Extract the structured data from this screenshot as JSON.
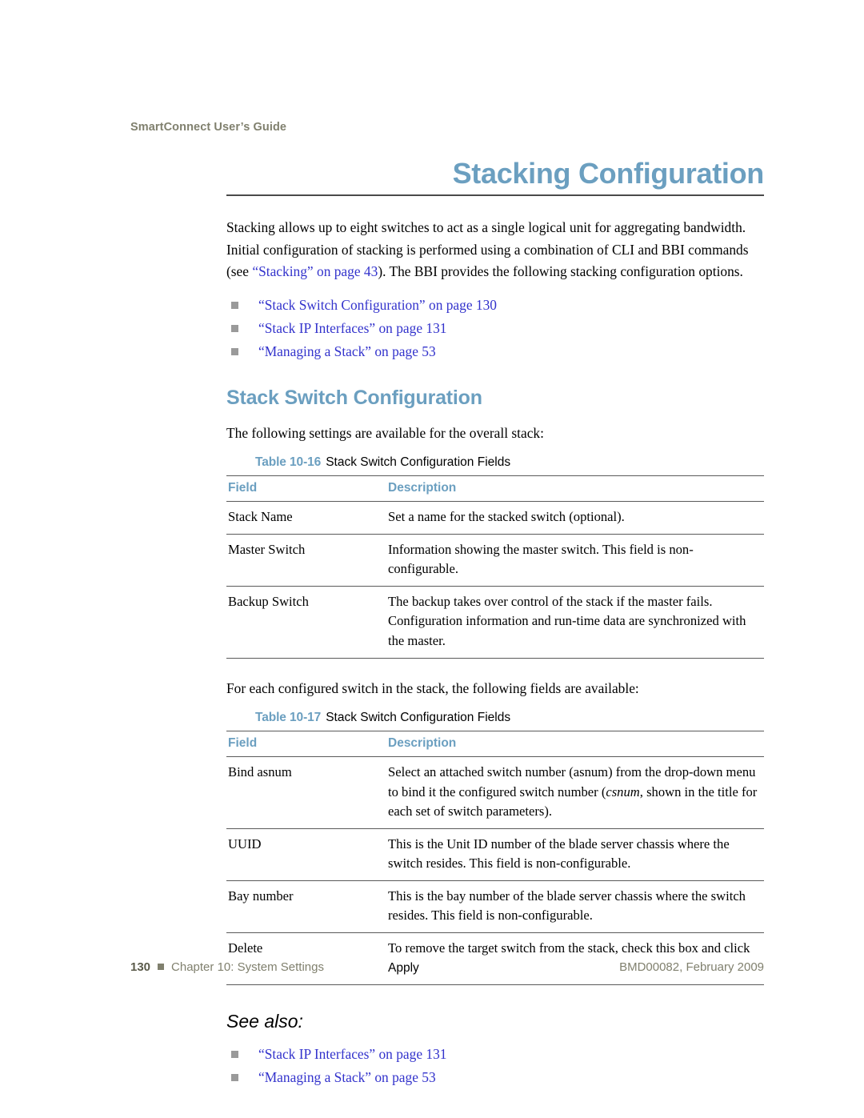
{
  "running_header": "SmartConnect User’s Guide",
  "title": "Stacking Configuration",
  "intro": {
    "part1": "Stacking allows up to eight switches to act as a single logical unit for aggregating bandwidth. Initial configuration of stacking is performed using a combination of CLI and BBI commands (see ",
    "link": "“Stacking” on page 43",
    "part2": "). The BBI provides the following stacking configuration options."
  },
  "toc_links": [
    "“Stack Switch Configuration” on page 130",
    "“Stack IP Interfaces” on page 131",
    "“Managing a Stack” on page 53"
  ],
  "section": {
    "heading": "Stack Switch Configuration",
    "lead_in": "The following settings are available for the overall stack:"
  },
  "table1": {
    "number": "Table 10-16",
    "label": "Stack Switch Configuration Fields",
    "headers": [
      "Field",
      "Description"
    ],
    "rows": [
      {
        "field": "Stack Name",
        "description": "Set a name for the stacked switch (optional)."
      },
      {
        "field": "Master Switch",
        "description": "Information showing the master switch. This field is non-configurable."
      },
      {
        "field": "Backup Switch",
        "description": "The backup takes over control of the stack if the master fails. Configuration information and run-time data are synchronized with the master."
      }
    ]
  },
  "table2_lead_in": "For each configured switch in the stack, the following fields are available:",
  "table2": {
    "number": "Table 10-17",
    "label": "Stack Switch Configuration Fields",
    "headers": [
      "Field",
      "Description"
    ],
    "rows": [
      {
        "field": "Bind asnum",
        "desc_pre": "Select an attached switch number (asnum) from the drop-down menu to bind it the configured switch number (",
        "desc_italic": "csnum",
        "desc_post": ", shown in the title for each set of switch parameters).",
        "desc_ui": ""
      },
      {
        "field": "UUID",
        "desc_pre": "This is the Unit ID number of the blade server chassis where the switch resides. This field is non-configurable.",
        "desc_italic": "",
        "desc_post": "",
        "desc_ui": ""
      },
      {
        "field": "Bay number",
        "desc_pre": "This is the bay number of the blade server chassis where the switch resides. This field is non-configurable.",
        "desc_italic": "",
        "desc_post": "",
        "desc_ui": ""
      },
      {
        "field": "Delete",
        "desc_pre": "To remove the target switch from the stack, check this box and click ",
        "desc_italic": "",
        "desc_post": "",
        "desc_ui": "Apply"
      }
    ]
  },
  "see_also": {
    "heading": "See also:",
    "links": [
      "“Stack IP Interfaces” on page 131",
      "“Managing a Stack” on page 53"
    ]
  },
  "footer": {
    "page_number": "130",
    "chapter": "Chapter 10: System Settings",
    "document_id": "BMD00082, February 2009"
  },
  "colors": {
    "accent_blue": "#6b9fc0",
    "link_blue": "#3333cc",
    "muted_olive": "#80806e",
    "rule_gray": "#5a5a5a",
    "bullet_gray": "#9a9a9a"
  }
}
